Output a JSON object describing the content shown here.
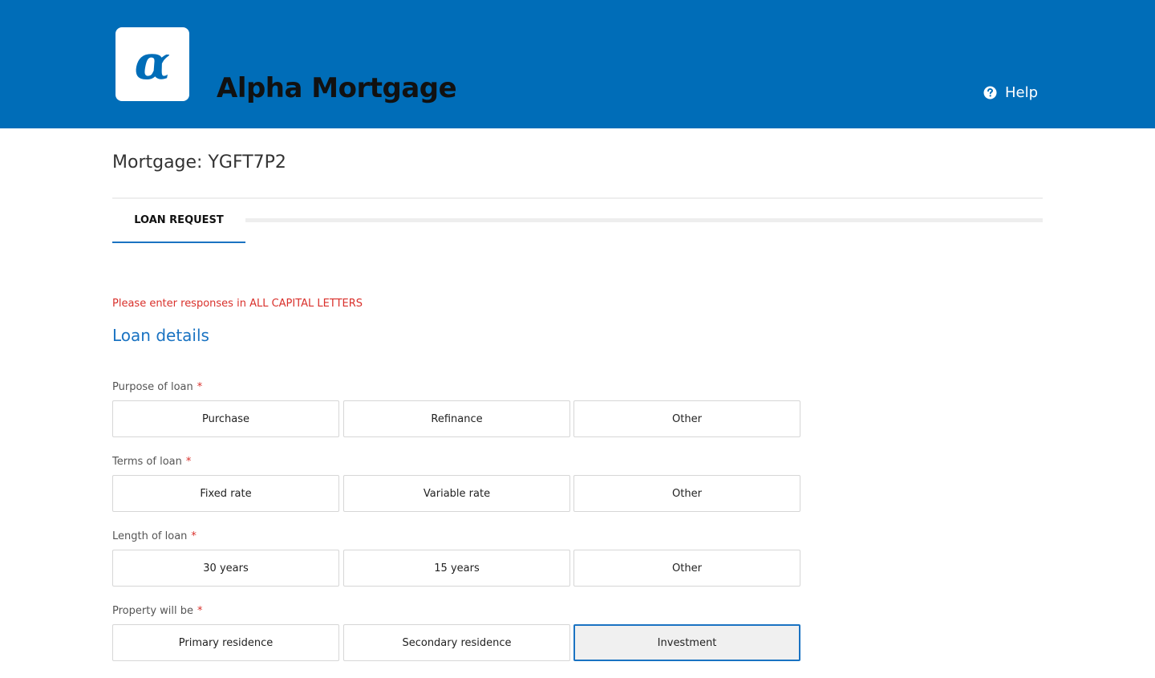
{
  "header": {
    "logo_glyph": "α",
    "app_name": "Alpha Mortgage",
    "help_label": "Help",
    "help_icon": "question-circle-icon",
    "background_color": "#006db8"
  },
  "page": {
    "title": "Mortgage: YGFT7P2"
  },
  "tabs": [
    {
      "label": "LOAN REQUEST",
      "active": true
    }
  ],
  "form": {
    "notice": "Please enter responses in ALL CAPITAL LETTERS",
    "section_title": "Loan details",
    "required_marker": "*",
    "fields": [
      {
        "label": "Purpose of loan",
        "options": [
          "Purchase",
          "Refinance",
          "Other"
        ],
        "selected": null
      },
      {
        "label": "Terms of loan",
        "options": [
          "Fixed rate",
          "Variable rate",
          "Other"
        ],
        "selected": null
      },
      {
        "label": "Length of loan",
        "options": [
          "30 years",
          "15 years",
          "Other"
        ],
        "selected": null
      },
      {
        "label": "Property will be",
        "options": [
          "Primary residence",
          "Secondary residence",
          "Investment"
        ],
        "selected": "Investment"
      }
    ]
  },
  "colors": {
    "accent": "#1a73c2",
    "error": "#d9302b"
  }
}
